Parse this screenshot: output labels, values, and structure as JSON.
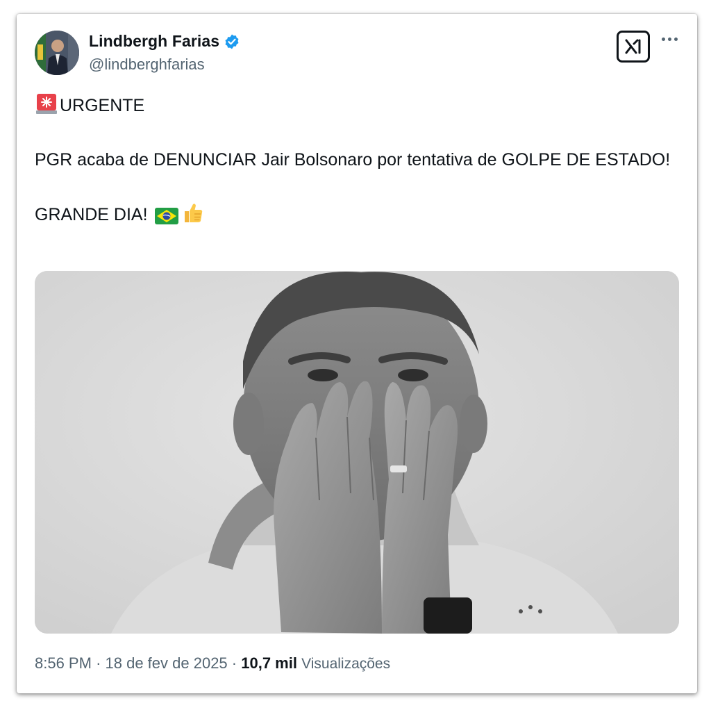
{
  "author": {
    "name": "Lindbergh Farias",
    "handle": "@lindberghfarias",
    "verified": true,
    "verified_color": "#1d9bf0"
  },
  "header": {
    "platform_icon": "x-logo-icon",
    "more_icon": "more-icon"
  },
  "tweet": {
    "line1_emoji": "siren-emoji",
    "line1": "URGENTE",
    "line2": "PGR acaba de DENUNCIAR Jair Bolsonaro por tentativa de GOLPE DE ESTADO!",
    "line3": "GRANDE DIA!",
    "line3_emojis": [
      "brazil-flag-emoji",
      "thumbs-up-emoji"
    ]
  },
  "media": {
    "type": "photo",
    "style": "black-and-white"
  },
  "footer": {
    "time": "8:56 PM",
    "separator": "·",
    "date": "18 de fev de 2025",
    "views_count": "10,7 mil",
    "views_label": "Visualizações"
  },
  "colors": {
    "text": "#0f1419",
    "secondary_text": "#536471",
    "background": "#ffffff"
  }
}
